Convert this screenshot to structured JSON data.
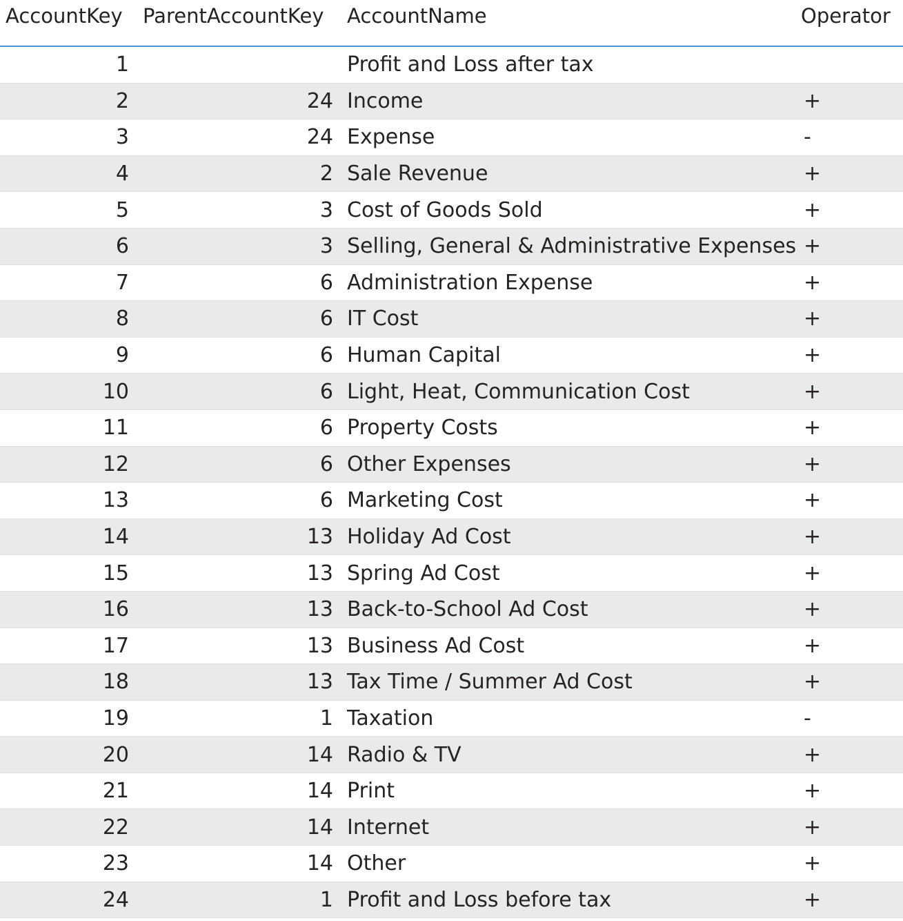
{
  "columns": {
    "account_key": "AccountKey",
    "parent_account_key": "ParentAccountKey",
    "account_name": "AccountName",
    "operator": "Operator"
  },
  "rows": [
    {
      "key": "1",
      "parent": "",
      "name": "Profit and Loss after tax",
      "op": ""
    },
    {
      "key": "2",
      "parent": "24",
      "name": "Income",
      "op": "+"
    },
    {
      "key": "3",
      "parent": "24",
      "name": "Expense",
      "op": "-"
    },
    {
      "key": "4",
      "parent": "2",
      "name": "Sale Revenue",
      "op": "+"
    },
    {
      "key": "5",
      "parent": "3",
      "name": "Cost of Goods Sold",
      "op": "+"
    },
    {
      "key": "6",
      "parent": "3",
      "name": "Selling, General & Administrative Expenses",
      "op": "+"
    },
    {
      "key": "7",
      "parent": "6",
      "name": "Administration Expense",
      "op": "+"
    },
    {
      "key": "8",
      "parent": "6",
      "name": "IT Cost",
      "op": "+"
    },
    {
      "key": "9",
      "parent": "6",
      "name": "Human Capital",
      "op": "+"
    },
    {
      "key": "10",
      "parent": "6",
      "name": "Light, Heat, Communication Cost",
      "op": "+"
    },
    {
      "key": "11",
      "parent": "6",
      "name": "Property Costs",
      "op": "+"
    },
    {
      "key": "12",
      "parent": "6",
      "name": "Other Expenses",
      "op": "+"
    },
    {
      "key": "13",
      "parent": "6",
      "name": "Marketing Cost",
      "op": "+"
    },
    {
      "key": "14",
      "parent": "13",
      "name": "Holiday Ad Cost",
      "op": "+"
    },
    {
      "key": "15",
      "parent": "13",
      "name": "Spring Ad Cost",
      "op": "+"
    },
    {
      "key": "16",
      "parent": "13",
      "name": "Back-to-School Ad Cost",
      "op": "+"
    },
    {
      "key": "17",
      "parent": "13",
      "name": "Business Ad Cost",
      "op": "+"
    },
    {
      "key": "18",
      "parent": "13",
      "name": "Tax Time / Summer Ad Cost",
      "op": "+"
    },
    {
      "key": "19",
      "parent": "1",
      "name": "Taxation",
      "op": "-"
    },
    {
      "key": "20",
      "parent": "14",
      "name": "Radio & TV",
      "op": "+"
    },
    {
      "key": "21",
      "parent": "14",
      "name": "Print",
      "op": "+"
    },
    {
      "key": "22",
      "parent": "14",
      "name": "Internet",
      "op": "+"
    },
    {
      "key": "23",
      "parent": "14",
      "name": "Other",
      "op": "+"
    },
    {
      "key": "24",
      "parent": "1",
      "name": "Profit and Loss before tax",
      "op": "+"
    }
  ],
  "colors": {
    "header_border": "#4a90d9",
    "row_alt": "#ebeaea",
    "text": "#252423"
  }
}
